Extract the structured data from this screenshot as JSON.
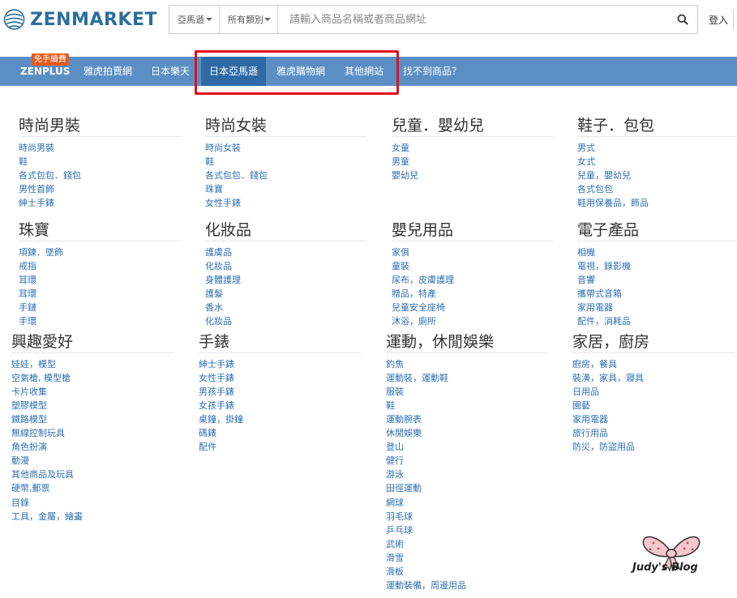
{
  "header": {
    "logo_text": "ZENMARKET",
    "search": {
      "site_select": "亞馬遜",
      "category_select": "所有類別",
      "placeholder": "請輸入商品名稱或者商品網址",
      "button_icon": "search-icon"
    },
    "login": "登入"
  },
  "nav": {
    "badge": "免手續費",
    "items": [
      {
        "label": "ZENPLUS"
      },
      {
        "label": "雅虎拍賣網"
      },
      {
        "label": "日本樂天"
      },
      {
        "label": "日本亞馬遜"
      },
      {
        "label": "雅虎購物網"
      },
      {
        "label": "其他網站"
      },
      {
        "label": "找不到商品？"
      }
    ],
    "active_color": "#2f6aa5",
    "bar_color": "#5b8fc4"
  },
  "categories": [
    {
      "title": "時尚男裝",
      "links": [
        "時尚男裝",
        "鞋",
        "各式包包．錢包",
        "男性首飾",
        "紳士手錶"
      ]
    },
    {
      "title": "時尚女裝",
      "links": [
        "時尚女裝",
        "鞋",
        "各式包包．錢包",
        "珠寶",
        "女性手錶"
      ]
    },
    {
      "title": "兒童．嬰幼兒",
      "links": [
        "女童",
        "男童",
        "嬰幼兒"
      ]
    },
    {
      "title": "鞋子．包包",
      "links": [
        "男式",
        "女式",
        "兒童，嬰幼兒",
        "各式包包",
        "鞋用保養品，飾品"
      ]
    },
    {
      "title": "珠寶",
      "links": [
        "項鍊．墜飾",
        "戒指",
        "耳環",
        "耳環",
        "手鏈",
        "手環"
      ]
    },
    {
      "title": "化妝品",
      "links": [
        "護膚品",
        "化妝品",
        "身體護理",
        "護髮",
        "香水",
        "化妝品"
      ]
    },
    {
      "title": "嬰兒用品",
      "links": [
        "家俱",
        "童裝",
        "尿布，皮膚護理",
        "贈品，特產",
        "兒童安全座椅",
        "沐浴，廁所"
      ]
    },
    {
      "title": "電子產品",
      "links": [
        "相機",
        "電視，錄影機",
        "音響",
        "攜帶式音箱",
        "家用電器",
        "配件，消耗品"
      ]
    },
    {
      "title": "興趣愛好",
      "links": [
        "娃娃，模型",
        "空氣槍, 模型槍",
        "卡片收集",
        "塑膠模型",
        "鐵路模型",
        "無線控制玩具",
        "角色扮演",
        "動漫",
        "其他商品及玩具",
        "硬幣,郵票",
        "目錄",
        "工具，金屬，繪畫"
      ]
    },
    {
      "title": "手錶",
      "links": [
        "紳士手錶",
        "女性手錶",
        "男孩手錶",
        "女孩手錶",
        "桌鐘，掛鐘",
        "碼錶",
        "配件"
      ]
    },
    {
      "title": "運動，休閒娛樂",
      "links": [
        "釣魚",
        "運動裝，運動鞋",
        "服裝",
        "鞋",
        "運動腕表",
        "休閒娛樂",
        "登山",
        "健行",
        "游泳",
        "田徑運動",
        "網球",
        "羽毛球",
        "乒乓球",
        "武術",
        "滑雪",
        "滑板",
        "運動裝備，周邊用品"
      ]
    },
    {
      "title": "家居，廚房",
      "links": [
        "廚房，餐具",
        "裝潢，家具，寢具",
        "日用品",
        "園藝",
        "家用電器",
        "旅行用品",
        "防災，防盜用品"
      ]
    }
  ],
  "watermark": {
    "text": "Judy's Blog",
    "icon": "bow-icon"
  },
  "colors": {
    "link": "#2c6fb3",
    "brand": "#2a6e9c",
    "highlight": "#e0121a",
    "badge": "#e85a1b"
  }
}
